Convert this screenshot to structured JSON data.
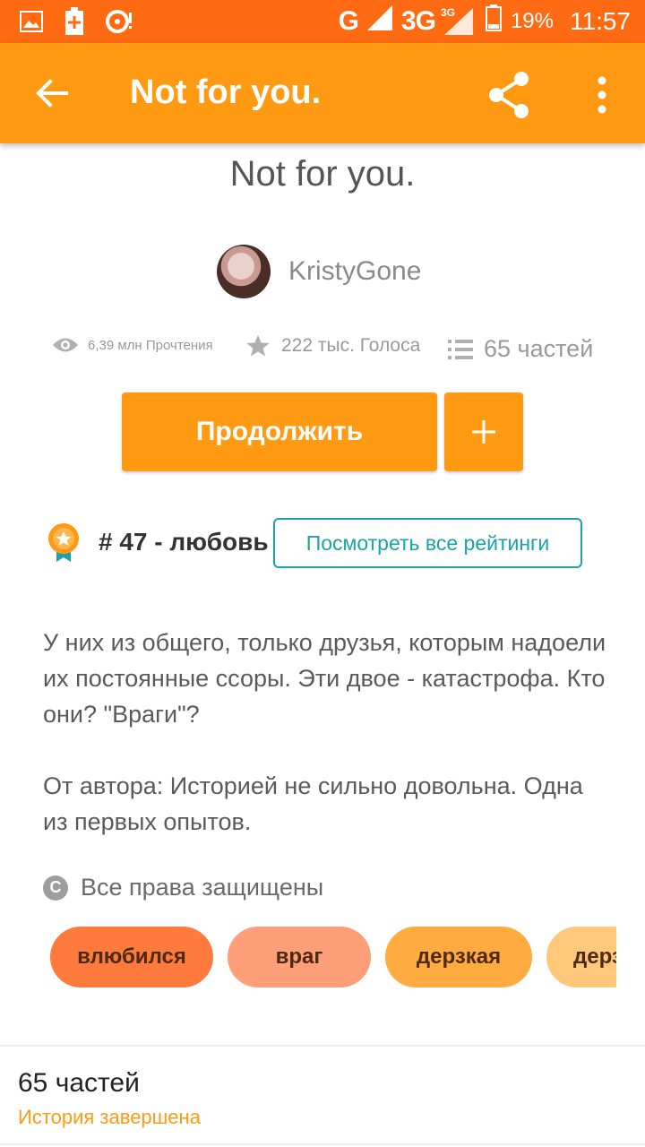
{
  "status_bar": {
    "network": "G",
    "network2": "3G",
    "network2_badge": "3G",
    "battery": "19%",
    "time": "11:57"
  },
  "app_bar": {
    "title": "Not for you."
  },
  "story": {
    "title": "Not for you.",
    "author": "KristyGone",
    "reads": "6,39 млн Прочтения",
    "votes": "222 тыс. Голоса",
    "parts": "65 частей"
  },
  "actions": {
    "continue_label": "Продолжить",
    "add_label": "+"
  },
  "ranking": {
    "text": "# 47 - любовь",
    "view_all_label": "Посмотреть все рейтинги"
  },
  "description": {
    "paragraph1": "У них из общего, только друзья, которым надоели их постоянные ссоры. Эти двое - катастрофа. Кто они? \"Враги\"?",
    "paragraph2": "От автора: Историей не сильно довольна. Одна из первых опытов."
  },
  "copyright": {
    "icon_letter": "C",
    "text": "Все права защищены"
  },
  "tags": [
    {
      "label": "влюбился",
      "color": "#ff7a3d"
    },
    {
      "label": "враг",
      "color": "#ff9f7a"
    },
    {
      "label": "дерзкая",
      "color": "#ffab40"
    },
    {
      "label": "дерзкий",
      "color": "#ffc87a"
    }
  ],
  "footer": {
    "parts": "65 частей",
    "status": "История завершена"
  },
  "colors": {
    "status_bar": "#ff6a13",
    "app_bar": "#ff9a12",
    "accent_teal": "#1aa3a8"
  }
}
